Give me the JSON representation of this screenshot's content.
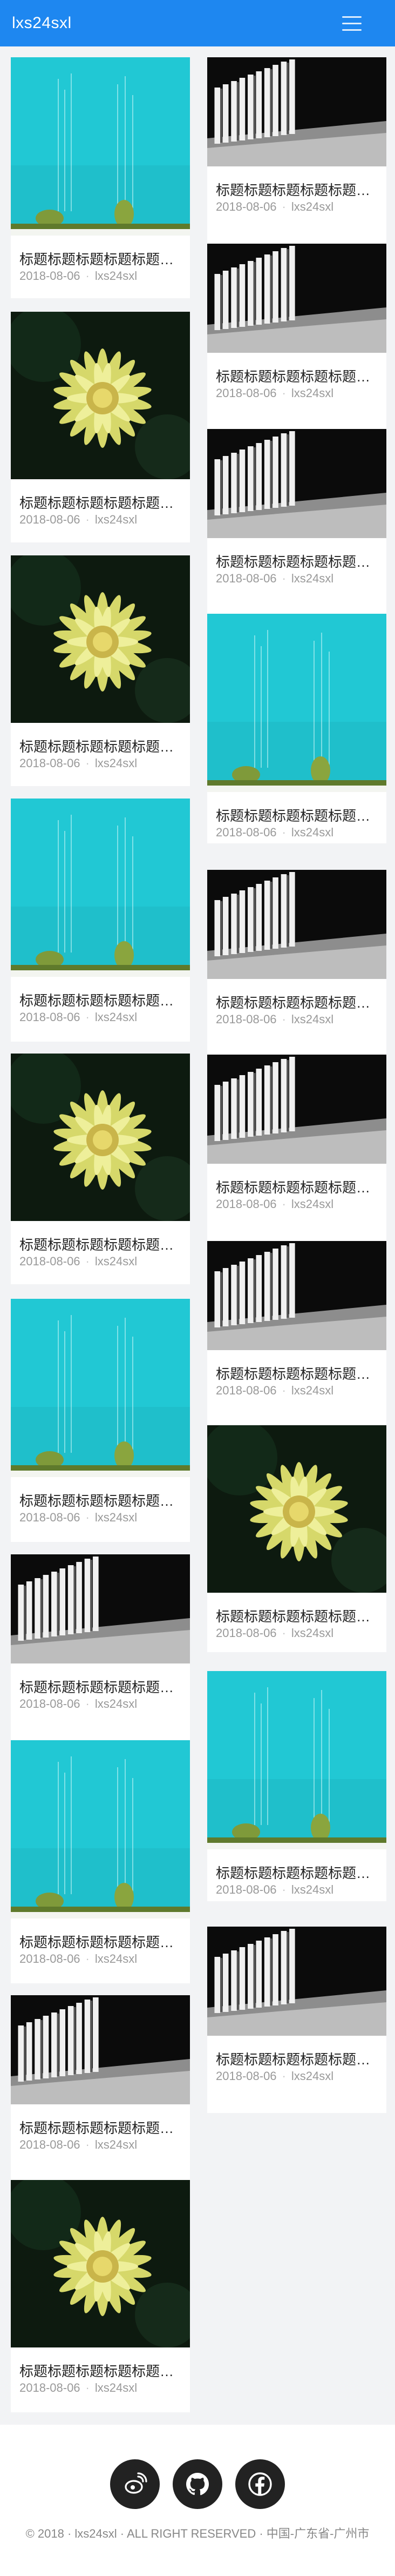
{
  "header": {
    "brand": "lxs24sxl",
    "menu_icon": "hamburger-icon"
  },
  "post": {
    "title": "标题标题标题标题标题…",
    "date": "2018-08-06",
    "separator": "·",
    "author": "lxs24sxl"
  },
  "cards": [
    {
      "image": "cactus"
    },
    {
      "image": "flower"
    },
    {
      "image": "flower"
    },
    {
      "image": "cactus"
    },
    {
      "image": "flower"
    },
    {
      "image": "cactus"
    },
    {
      "image": "fence"
    },
    {
      "image": "cactus"
    },
    {
      "image": "fence"
    },
    {
      "image": "flower"
    },
    {
      "image": "fence"
    },
    {
      "image": "fence"
    },
    {
      "image": "fence"
    },
    {
      "image": "cactus"
    },
    {
      "image": "fence"
    },
    {
      "image": "fence"
    },
    {
      "image": "fence"
    },
    {
      "image": "flower"
    },
    {
      "image": "cactus"
    },
    {
      "image": "fence"
    }
  ],
  "footer": {
    "social": [
      {
        "name": "weibo",
        "icon": "weibo-icon"
      },
      {
        "name": "github",
        "icon": "github-icon"
      },
      {
        "name": "facebook",
        "icon": "facebook-icon"
      }
    ],
    "copyright": "© 2018 · lxs24sxl · ALL RIGHT RESERVED · 中国-广东省-广州市"
  },
  "colors": {
    "accent": "#1e87f0",
    "cactus_bg": "#23c6d2",
    "flower_bg": "#0e1a10",
    "flower_petal": "#dfe07a"
  }
}
